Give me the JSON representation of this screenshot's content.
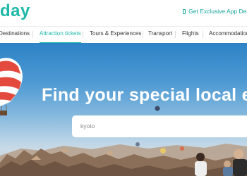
{
  "header": {
    "logo_text": "day",
    "app_deal_label": "Get Exclusive App Deal",
    "accent_color": "#1fb9a9"
  },
  "nav": {
    "items": [
      {
        "label": "Destinations"
      },
      {
        "label": "Attraction tickets",
        "active": true
      },
      {
        "label": "Tours & Experiences"
      },
      {
        "label": "Transport"
      },
      {
        "label": "Flights"
      },
      {
        "label": "Accommodation"
      }
    ]
  },
  "hero": {
    "headline": "Find your special local ex",
    "search_value": "kyoto"
  }
}
